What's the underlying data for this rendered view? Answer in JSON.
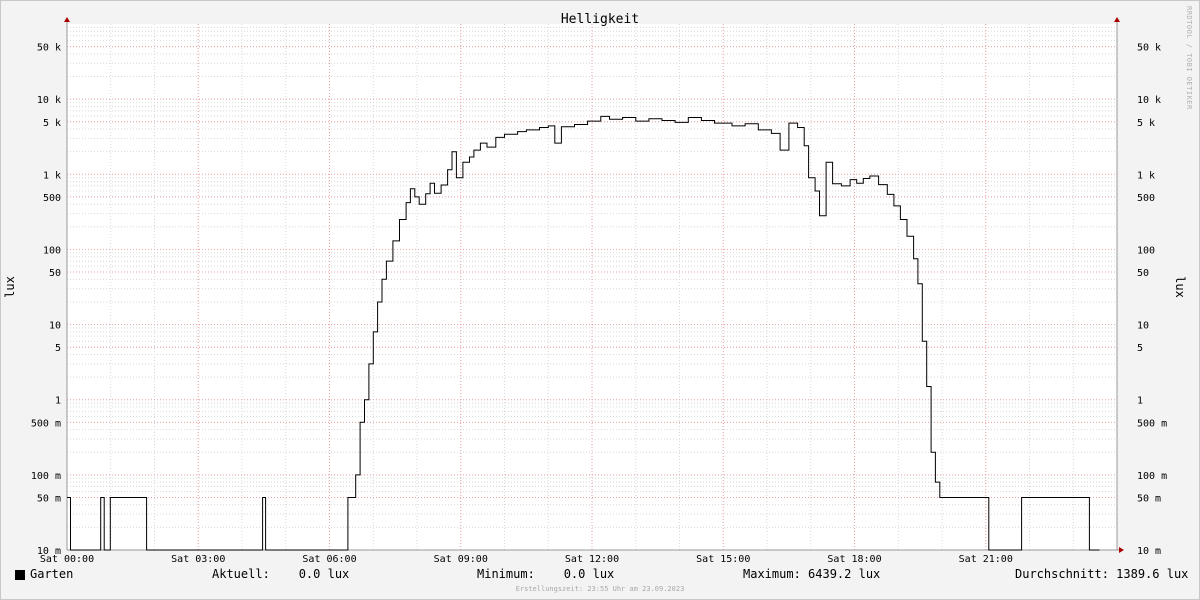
{
  "chart_data": {
    "type": "line",
    "title": "Helligkeit",
    "ylabel": "lux",
    "ylabel_right": "lux",
    "yscale": "log",
    "ylim": [
      0.01,
      100000
    ],
    "xlim": [
      0,
      24
    ],
    "grid": true,
    "y_ticks": [
      {
        "value": 0.01,
        "label": "10 m"
      },
      {
        "value": 0.05,
        "label": "50 m"
      },
      {
        "value": 0.1,
        "label": "100 m"
      },
      {
        "value": 0.5,
        "label": "500 m"
      },
      {
        "value": 1,
        "label": "1"
      },
      {
        "value": 5,
        "label": "5"
      },
      {
        "value": 10,
        "label": "10"
      },
      {
        "value": 50,
        "label": "50"
      },
      {
        "value": 100,
        "label": "100"
      },
      {
        "value": 500,
        "label": "500"
      },
      {
        "value": 1000,
        "label": "1 k"
      },
      {
        "value": 5000,
        "label": "5 k"
      },
      {
        "value": 10000,
        "label": "10 k"
      },
      {
        "value": 50000,
        "label": "50 k"
      }
    ],
    "x_ticks": [
      {
        "value": 0,
        "label": "Sat 00:00"
      },
      {
        "value": 3,
        "label": "Sat 03:00"
      },
      {
        "value": 6,
        "label": "Sat 06:00"
      },
      {
        "value": 9,
        "label": "Sat 09:00"
      },
      {
        "value": 12,
        "label": "Sat 12:00"
      },
      {
        "value": 15,
        "label": "Sat 15:00"
      },
      {
        "value": 18,
        "label": "Sat 18:00"
      },
      {
        "value": 21,
        "label": "Sat 21:00"
      }
    ],
    "series": [
      {
        "name": "Garten",
        "color": "#000000",
        "points": [
          [
            0.0,
            0.05
          ],
          [
            0.05,
            0.05
          ],
          [
            0.08,
            0.01
          ],
          [
            0.75,
            0.01
          ],
          [
            0.77,
            0.05
          ],
          [
            0.83,
            0.05
          ],
          [
            0.85,
            0.01
          ],
          [
            0.97,
            0.01
          ],
          [
            0.99,
            0.05
          ],
          [
            1.8,
            0.05
          ],
          [
            1.82,
            0.01
          ],
          [
            4.45,
            0.01
          ],
          [
            4.47,
            0.05
          ],
          [
            4.52,
            0.05
          ],
          [
            4.54,
            0.01
          ],
          [
            6.4,
            0.01
          ],
          [
            6.42,
            0.05
          ],
          [
            6.55,
            0.05
          ],
          [
            6.6,
            0.1
          ],
          [
            6.7,
            0.5
          ],
          [
            6.8,
            1
          ],
          [
            6.9,
            3
          ],
          [
            7.0,
            8
          ],
          [
            7.1,
            20
          ],
          [
            7.2,
            40
          ],
          [
            7.3,
            70
          ],
          [
            7.45,
            130
          ],
          [
            7.6,
            250
          ],
          [
            7.75,
            420
          ],
          [
            7.85,
            640
          ],
          [
            7.95,
            500
          ],
          [
            8.05,
            400
          ],
          [
            8.2,
            550
          ],
          [
            8.3,
            760
          ],
          [
            8.4,
            560
          ],
          [
            8.55,
            720
          ],
          [
            8.7,
            1150
          ],
          [
            8.8,
            2000
          ],
          [
            8.9,
            900
          ],
          [
            9.05,
            1450
          ],
          [
            9.2,
            1700
          ],
          [
            9.3,
            2100
          ],
          [
            9.45,
            2600
          ],
          [
            9.6,
            2300
          ],
          [
            9.8,
            3100
          ],
          [
            10.0,
            3400
          ],
          [
            10.3,
            3700
          ],
          [
            10.5,
            3900
          ],
          [
            10.8,
            4200
          ],
          [
            11.0,
            4400
          ],
          [
            11.15,
            2600
          ],
          [
            11.3,
            4300
          ],
          [
            11.6,
            4600
          ],
          [
            11.9,
            5100
          ],
          [
            12.2,
            5900
          ],
          [
            12.4,
            5400
          ],
          [
            12.7,
            5700
          ],
          [
            13.0,
            5100
          ],
          [
            13.3,
            5500
          ],
          [
            13.6,
            5200
          ],
          [
            13.9,
            4900
          ],
          [
            14.2,
            5700
          ],
          [
            14.5,
            5200
          ],
          [
            14.8,
            4800
          ],
          [
            15.2,
            4400
          ],
          [
            15.5,
            4700
          ],
          [
            15.8,
            3900
          ],
          [
            16.1,
            3500
          ],
          [
            16.3,
            2100
          ],
          [
            16.5,
            4800
          ],
          [
            16.7,
            4200
          ],
          [
            16.85,
            2400
          ],
          [
            16.95,
            900
          ],
          [
            17.1,
            600
          ],
          [
            17.2,
            280
          ],
          [
            17.35,
            1450
          ],
          [
            17.5,
            750
          ],
          [
            17.7,
            700
          ],
          [
            17.9,
            850
          ],
          [
            18.05,
            760
          ],
          [
            18.2,
            880
          ],
          [
            18.35,
            950
          ],
          [
            18.55,
            730
          ],
          [
            18.75,
            540
          ],
          [
            18.9,
            380
          ],
          [
            19.05,
            250
          ],
          [
            19.2,
            150
          ],
          [
            19.35,
            75
          ],
          [
            19.45,
            35
          ],
          [
            19.55,
            6
          ],
          [
            19.65,
            1.5
          ],
          [
            19.75,
            0.2
          ],
          [
            19.85,
            0.08
          ],
          [
            19.95,
            0.05
          ],
          [
            21.05,
            0.05
          ],
          [
            21.07,
            0.01
          ],
          [
            21.8,
            0.01
          ],
          [
            21.82,
            0.05
          ],
          [
            23.35,
            0.05
          ],
          [
            23.37,
            0.01
          ],
          [
            23.6,
            0.01
          ]
        ]
      }
    ]
  },
  "legend": {
    "series_name": "Garten",
    "current": "Aktuell:    0.0 lux",
    "minimum": "Minimum:    0.0 lux",
    "maximum": "Maximum: 6439.2 lux",
    "average": "Durchschnitt: 1389.6 lux"
  },
  "footer": "Erstellungszeit: 23:55 Uhr am 23.09.2023",
  "watermark": "RRDTOOL / TOBI OETIKER",
  "colors": {
    "plot_background": "#ffffff",
    "major_grid": "#e8a0a0",
    "minor_grid": "#d8d8d8",
    "axis": "#999999",
    "arrow": "#aa0000",
    "line": "#000000"
  }
}
